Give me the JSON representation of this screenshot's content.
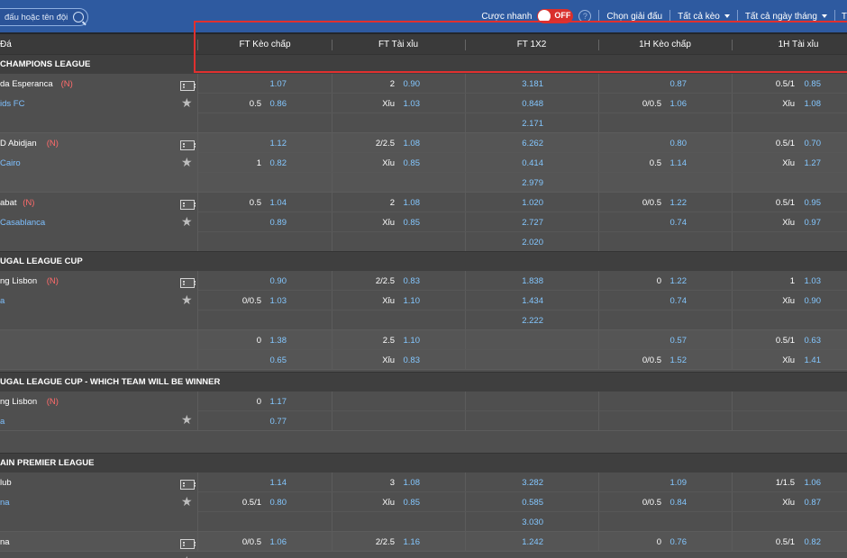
{
  "topbar": {
    "search_placeholder": "đấu hoặc tên đội",
    "quick_bet_label": "Cược nhanh",
    "toggle_state": "OFF",
    "help_symbol": "?",
    "choose_league": "Chọn giải đấu",
    "all_bets": "Tất cả kèo",
    "all_days": "Tất cả ngày tháng",
    "extra": "T"
  },
  "columns": {
    "match": "Đá",
    "ft_handicap": "FT Kèo chấp",
    "ft_overunder": "FT Tài xỉu",
    "ft_1x2": "FT 1X2",
    "h1_handicap": "1H Kèo chấp",
    "h1_overunder": "1H Tài xỉu"
  },
  "leagues": [
    {
      "name": "CHAMPIONS LEAGUE",
      "matches": [
        {
          "home": "da Esperanca",
          "home_tag": "(N)",
          "away": "ids FC",
          "away_tag": "",
          "lines": [
            {
              "hc": "",
              "hc_odd": "1.07",
              "ou": "2",
              "ou_odd": "0.90",
              "x12": "3.181",
              "h1hc": "",
              "h1hc_odd": "0.87",
              "h1ou": "0.5/1",
              "h1ou_odd": "0.85"
            },
            {
              "hc": "0.5",
              "hc_odd": "0.86",
              "ou": "Xỉu",
              "ou_odd": "1.03",
              "x12": "0.848",
              "h1hc": "0/0.5",
              "h1hc_odd": "1.06",
              "h1ou": "Xỉu",
              "h1ou_odd": "1.08"
            },
            {
              "hc": "",
              "hc_odd": "",
              "ou": "",
              "ou_odd": "",
              "x12": "2.171",
              "h1hc": "",
              "h1hc_odd": "",
              "h1ou": "",
              "h1ou_odd": ""
            }
          ]
        },
        {
          "home": "D Abidjan",
          "home_tag": "(N)",
          "away": "Cairo",
          "away_tag": "",
          "lines": [
            {
              "hc": "",
              "hc_odd": "1.12",
              "ou": "2/2.5",
              "ou_odd": "1.08",
              "x12": "6.262",
              "h1hc": "",
              "h1hc_odd": "0.80",
              "h1ou": "0.5/1",
              "h1ou_odd": "0.70"
            },
            {
              "hc": "1",
              "hc_odd": "0.82",
              "ou": "Xỉu",
              "ou_odd": "0.85",
              "x12": "0.414",
              "h1hc": "0.5",
              "h1hc_odd": "1.14",
              "h1ou": "Xỉu",
              "h1ou_odd": "1.27"
            },
            {
              "hc": "",
              "hc_odd": "",
              "ou": "",
              "ou_odd": "",
              "x12": "2.979",
              "h1hc": "",
              "h1hc_odd": "",
              "h1ou": "",
              "h1ou_odd": ""
            }
          ]
        },
        {
          "home": "abat",
          "home_tag": "(N)",
          "away": "Casablanca",
          "away_tag": "",
          "lines": [
            {
              "hc": "0.5",
              "hc_odd": "1.04",
              "ou": "2",
              "ou_odd": "1.08",
              "x12": "1.020",
              "h1hc": "0/0.5",
              "h1hc_odd": "1.22",
              "h1ou": "0.5/1",
              "h1ou_odd": "0.95"
            },
            {
              "hc": "",
              "hc_odd": "0.89",
              "ou": "Xỉu",
              "ou_odd": "0.85",
              "x12": "2.727",
              "h1hc": "",
              "h1hc_odd": "0.74",
              "h1ou": "Xỉu",
              "h1ou_odd": "0.97"
            },
            {
              "hc": "",
              "hc_odd": "",
              "ou": "",
              "ou_odd": "",
              "x12": "2.020",
              "h1hc": "",
              "h1hc_odd": "",
              "h1ou": "",
              "h1ou_odd": ""
            }
          ]
        }
      ]
    },
    {
      "name": "UGAL LEAGUE CUP",
      "matches": [
        {
          "home": "ng Lisbon",
          "home_tag": "(N)",
          "away": "a",
          "away_tag": "",
          "lines": [
            {
              "hc": "",
              "hc_odd": "0.90",
              "ou": "2/2.5",
              "ou_odd": "0.83",
              "x12": "1.838",
              "h1hc": "0",
              "h1hc_odd": "1.22",
              "h1ou": "1",
              "h1ou_odd": "1.03"
            },
            {
              "hc": "0/0.5",
              "hc_odd": "1.03",
              "ou": "Xỉu",
              "ou_odd": "1.10",
              "x12": "1.434",
              "h1hc": "",
              "h1hc_odd": "0.74",
              "h1ou": "Xỉu",
              "h1ou_odd": "0.90"
            },
            {
              "hc": "",
              "hc_odd": "",
              "ou": "",
              "ou_odd": "",
              "x12": "2.222",
              "h1hc": "",
              "h1hc_odd": "",
              "h1ou": "",
              "h1ou_odd": ""
            }
          ]
        },
        {
          "home": "",
          "home_tag": "",
          "away": "",
          "away_tag": "",
          "lines": [
            {
              "hc": "0",
              "hc_odd": "1.38",
              "ou": "2.5",
              "ou_odd": "1.10",
              "x12": "",
              "h1hc": "",
              "h1hc_odd": "0.57",
              "h1ou": "0.5/1",
              "h1ou_odd": "0.63"
            },
            {
              "hc": "",
              "hc_odd": "0.65",
              "ou": "Xỉu",
              "ou_odd": "0.83",
              "x12": "",
              "h1hc": "0/0.5",
              "h1hc_odd": "1.52",
              "h1ou": "Xỉu",
              "h1ou_odd": "1.41"
            }
          ]
        }
      ]
    },
    {
      "name": "UGAL LEAGUE CUP - WHICH TEAM WILL BE WINNER",
      "matches": [
        {
          "home": "ng Lisbon",
          "home_tag": "(N)",
          "away": "a",
          "away_tag": "",
          "lines": [
            {
              "hc": "0",
              "hc_odd": "1.17",
              "ou": "",
              "ou_odd": "",
              "x12": "",
              "h1hc": "",
              "h1hc_odd": "",
              "h1ou": "",
              "h1ou_odd": ""
            },
            {
              "hc": "",
              "hc_odd": "0.77",
              "ou": "",
              "ou_odd": "",
              "x12": "",
              "h1hc": "",
              "h1hc_odd": "",
              "h1ou": "",
              "h1ou_odd": ""
            }
          ]
        }
      ]
    },
    {
      "name": "AIN PREMIER LEAGUE",
      "matches": [
        {
          "home": "lub",
          "home_tag": "",
          "away": "na",
          "away_tag": "",
          "lines": [
            {
              "hc": "",
              "hc_odd": "1.14",
              "ou": "3",
              "ou_odd": "1.08",
              "x12": "3.282",
              "h1hc": "",
              "h1hc_odd": "1.09",
              "h1ou": "1/1.5",
              "h1ou_odd": "1.06"
            },
            {
              "hc": "0.5/1",
              "hc_odd": "0.80",
              "ou": "Xỉu",
              "ou_odd": "0.85",
              "x12": "0.585",
              "h1hc": "0/0.5",
              "h1hc_odd": "0.84",
              "h1ou": "Xỉu",
              "h1ou_odd": "0.87"
            },
            {
              "hc": "",
              "hc_odd": "",
              "ou": "",
              "ou_odd": "",
              "x12": "3.030",
              "h1hc": "",
              "h1hc_odd": "",
              "h1ou": "",
              "h1ou_odd": ""
            }
          ]
        },
        {
          "home": "na",
          "home_tag": "",
          "away": "",
          "away_tag": "",
          "lines": [
            {
              "hc": "0/0.5",
              "hc_odd": "1.06",
              "ou": "2/2.5",
              "ou_odd": "1.16",
              "x12": "1.242",
              "h1hc": "0",
              "h1hc_odd": "0.76",
              "h1ou": "0.5/1",
              "h1ou_odd": "0.82"
            }
          ]
        }
      ]
    }
  ],
  "colors": {
    "topbar": "#2e5aa0",
    "odd": "#84c7ff",
    "away_team": "#7ec0ff",
    "neutral_tag": "#ff6b6b",
    "highlight": "#e0302f",
    "toggle": "#d9302c"
  }
}
